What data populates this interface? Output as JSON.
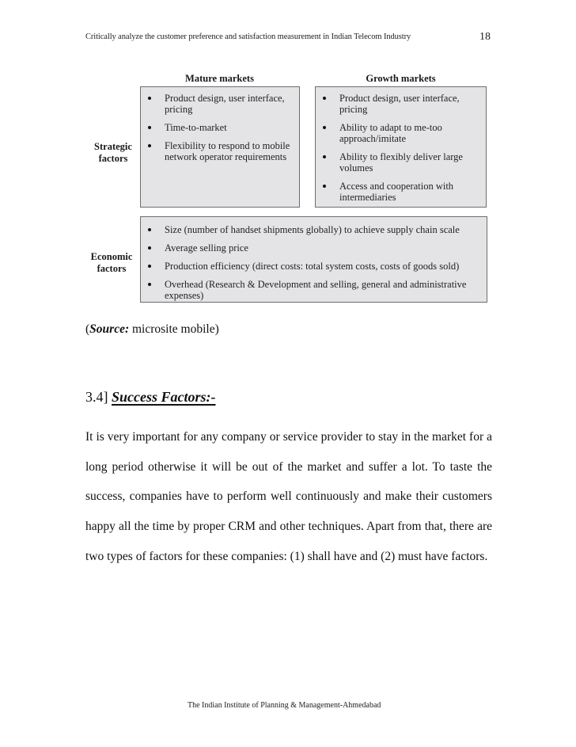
{
  "header": {
    "title": "Critically analyze the customer preference and satisfaction measurement in Indian Telecom Industry",
    "page_number": "18"
  },
  "figure": {
    "columns": {
      "mature": "Mature markets",
      "growth": "Growth markets"
    },
    "rows": {
      "strategic_label": [
        "Strategic",
        "factors"
      ],
      "economic_label": [
        "Economic",
        "factors"
      ]
    },
    "strategic": {
      "mature_items": [
        "Product design, user interface, pricing",
        "Time-to-market",
        "Flexibility to respond to mobile network operator requirements"
      ],
      "growth_items": [
        "Product design, user interface, pricing",
        "Ability to adapt to me-too approach/imitate",
        "Ability to flexibly deliver large volumes",
        "Access and cooperation with intermediaries"
      ]
    },
    "economic_items": [
      "Size (number of handset shipments globally) to achieve supply chain scale",
      "Average selling price",
      "Production efficiency (direct costs: total system costs, costs of goods sold)",
      "Overhead (Research & Development and selling, general and administrative expenses)"
    ]
  },
  "source": {
    "open": "(",
    "label": "Source:",
    "text": " microsite mobile)"
  },
  "section": {
    "number": "3.4]",
    "title": "Success Factors:-"
  },
  "body": {
    "paragraph": "It is very important for any company or service provider to stay in the market for a long period otherwise it will be out of the market and suffer a lot. To taste the success, companies have to perform well continuously and make their customers happy all the time by proper CRM and other techniques. Apart from that, there are two types of factors for these companies: (1) shall have and (2) must have factors."
  },
  "footer": {
    "text": "The Indian Institute of Planning & Management-Ahmedabad"
  }
}
